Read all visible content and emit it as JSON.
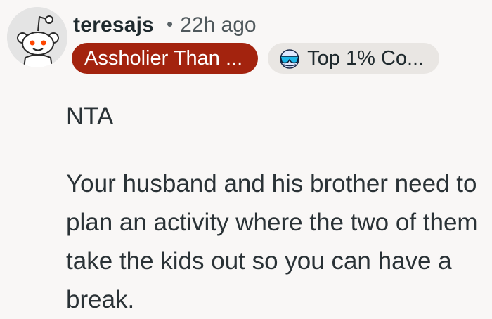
{
  "comment": {
    "author": {
      "username": "teresajs",
      "avatar_icon": "reddit-snoo-avatar-icon"
    },
    "separator": "•",
    "timestamp": "22h ago",
    "flairs": [
      {
        "label": "Assholier Than ...",
        "background": "#a3230e",
        "color": "#ffffff"
      },
      {
        "label": "Top 1% Co...",
        "icon": "sunglasses-icon",
        "background": "#e9e6e3",
        "color": "#1f2a2e"
      }
    ],
    "body": {
      "paragraphs": [
        "NTA",
        "Your husband and his brother need to plan an activity where the two of them take the kids out so you can have a break."
      ]
    }
  }
}
